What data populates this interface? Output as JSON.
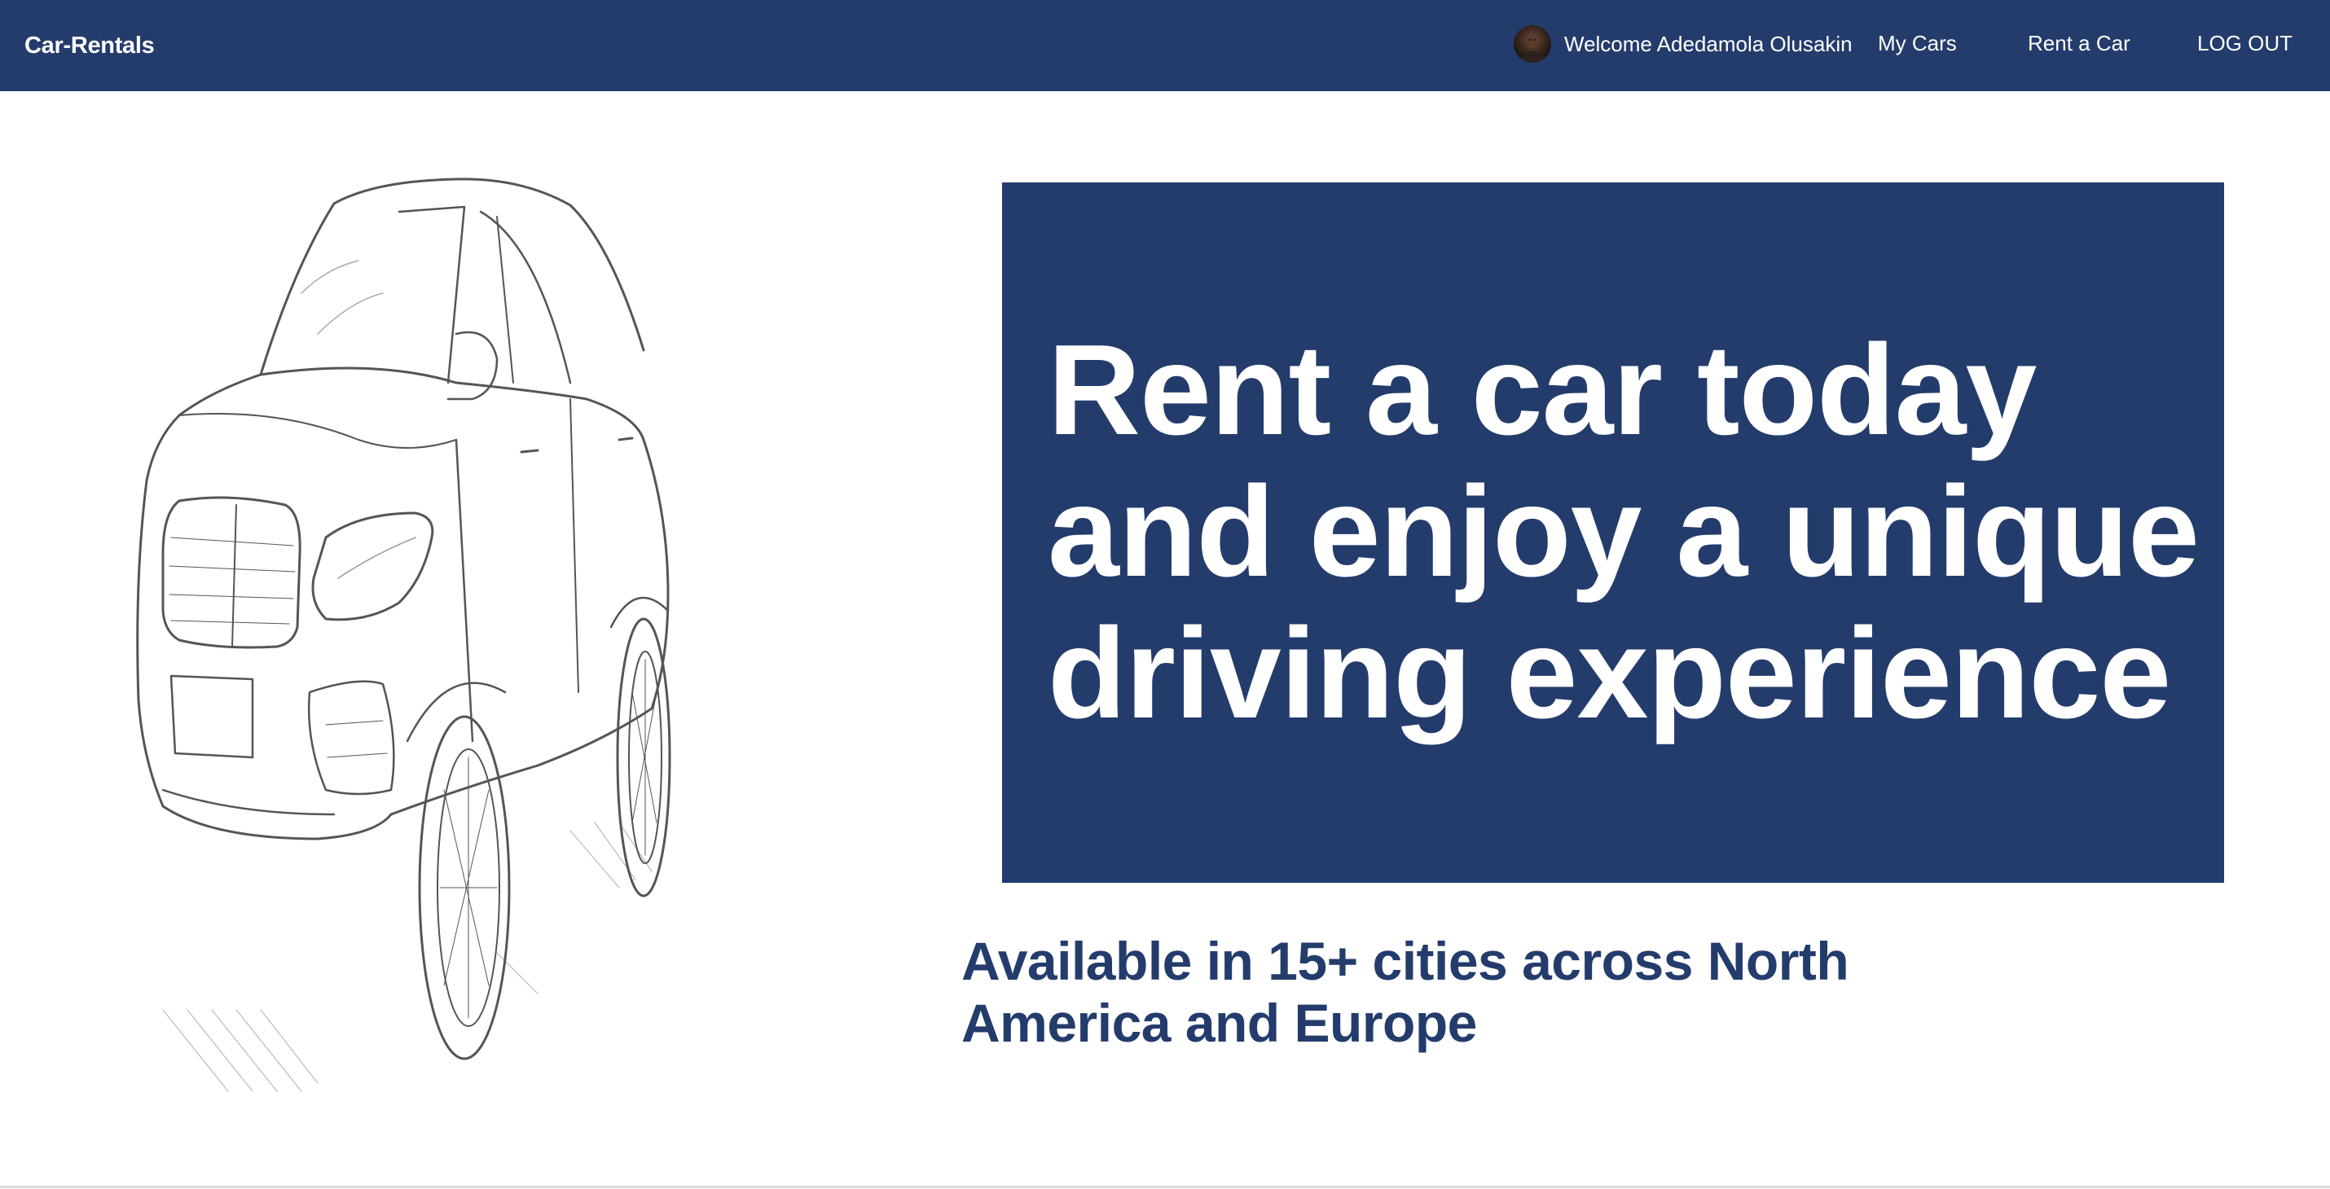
{
  "navbar": {
    "brand": "Car-Rentals",
    "welcome": "Welcome Adedamola Olusakin",
    "links": {
      "my_cars": "My Cars",
      "rent_a_car": "Rent a Car",
      "logout": "LOG OUT"
    }
  },
  "hero": {
    "title": "Rent a car today and enjoy a unique driving experience",
    "subtitle": "Available in 15+ cities across North America and Europe"
  },
  "colors": {
    "primary": "#243c6c",
    "background": "#ffffff",
    "text_on_primary": "#ffffff"
  },
  "icons": {
    "avatar": "user-avatar-photo",
    "hero_image": "car-sketch-illustration"
  }
}
